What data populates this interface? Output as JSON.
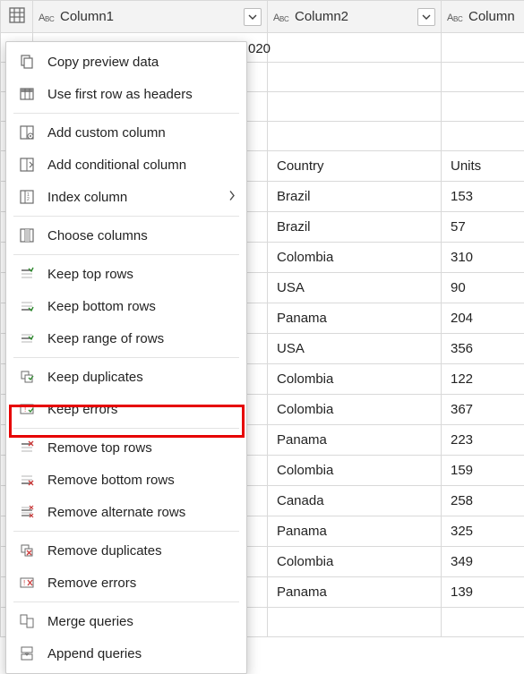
{
  "columns": {
    "col1_label": "Column1",
    "col2_label": "Column2",
    "col3_label": "Column"
  },
  "table_rows": [
    {
      "c1": "",
      "c2": "",
      "c3": ""
    },
    {
      "c1": "",
      "c2": "",
      "c3": ""
    },
    {
      "c1": "",
      "c2": "",
      "c3": ""
    },
    {
      "c1": "",
      "c2": "",
      "c3": ""
    },
    {
      "c1": "",
      "c2": "Country",
      "c3": "Units"
    },
    {
      "c1": "",
      "c2": "Brazil",
      "c3": "153"
    },
    {
      "c1": "",
      "c2": "Brazil",
      "c3": "57"
    },
    {
      "c1": "",
      "c2": "Colombia",
      "c3": "310"
    },
    {
      "c1": "",
      "c2": "USA",
      "c3": "90"
    },
    {
      "c1": "",
      "c2": "Panama",
      "c3": "204"
    },
    {
      "c1": "",
      "c2": "USA",
      "c3": "356"
    },
    {
      "c1": "",
      "c2": "Colombia",
      "c3": "122"
    },
    {
      "c1": "",
      "c2": "Colombia",
      "c3": "367"
    },
    {
      "c1": "",
      "c2": "Panama",
      "c3": "223"
    },
    {
      "c1": "",
      "c2": "Colombia",
      "c3": "159"
    },
    {
      "c1": "",
      "c2": "Canada",
      "c3": "258"
    },
    {
      "c1": "",
      "c2": "Panama",
      "c3": "325"
    },
    {
      "c1": "",
      "c2": "Colombia",
      "c3": "349"
    },
    {
      "c1": "",
      "c2": "Panama",
      "c3": "139"
    },
    {
      "c1": "",
      "c2": "",
      "c3": ""
    }
  ],
  "visible_cell_behind_menu": "020",
  "menu": {
    "copy_preview": "Copy preview data",
    "first_row_headers": "Use first row as headers",
    "add_custom_col": "Add custom column",
    "add_conditional_col": "Add conditional column",
    "index_col": "Index column",
    "choose_cols": "Choose columns",
    "keep_top": "Keep top rows",
    "keep_bottom": "Keep bottom rows",
    "keep_range": "Keep range of rows",
    "keep_dupes": "Keep duplicates",
    "keep_errors": "Keep errors",
    "remove_top": "Remove top rows",
    "remove_bottom": "Remove bottom rows",
    "remove_alternate": "Remove alternate rows",
    "remove_dupes": "Remove duplicates",
    "remove_errors": "Remove errors",
    "merge": "Merge queries",
    "append": "Append queries"
  }
}
